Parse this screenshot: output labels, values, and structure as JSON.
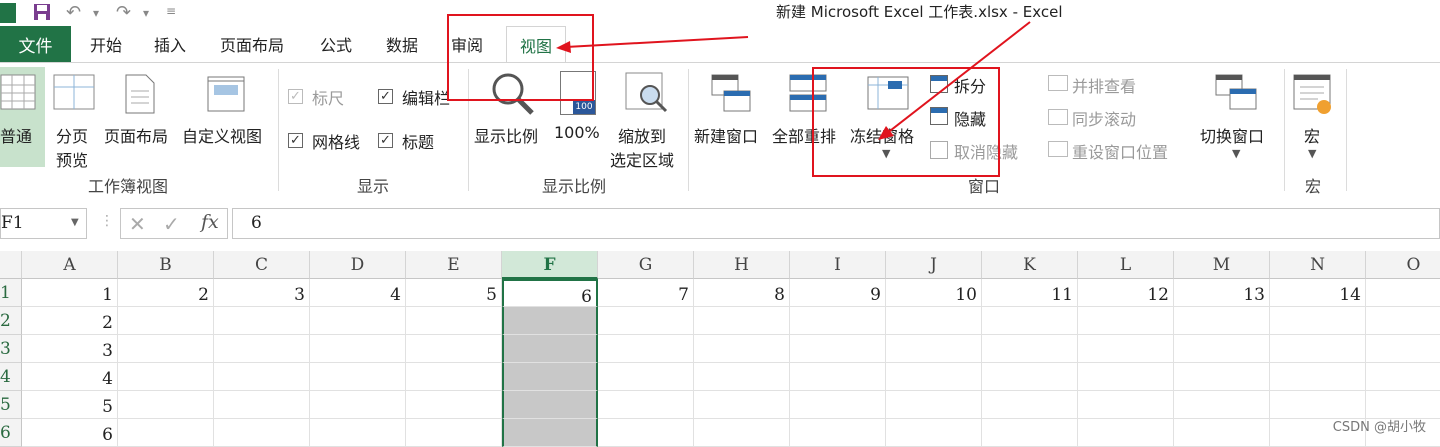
{
  "window": {
    "title": "新建 Microsoft Excel 工作表.xlsx - Excel"
  },
  "tabs": {
    "file": "文件",
    "items": [
      "开始",
      "插入",
      "页面布局",
      "公式",
      "数据",
      "审阅"
    ],
    "active": "视图"
  },
  "ribbon": {
    "workbook_views": {
      "label": "工作簿视图",
      "normal": "普通",
      "page_break_1": "分页",
      "page_break_2": "预览",
      "page_layout": "页面布局",
      "custom_views": "自定义视图"
    },
    "show": {
      "label": "显示",
      "ruler": "标尺",
      "formula_bar": "编辑栏",
      "gridlines": "网格线",
      "headings": "标题"
    },
    "zoom": {
      "label": "显示比例",
      "zoom": "显示比例",
      "hundred": "100%",
      "hundred_icon_text": "100",
      "zoom_to_selection_1": "缩放到",
      "zoom_to_selection_2": "选定区域"
    },
    "window": {
      "label": "窗口",
      "new_window": "新建窗口",
      "arrange_all": "全部重排",
      "freeze_panes": "冻结窗格",
      "split": "拆分",
      "hide": "隐藏",
      "unhide": "取消隐藏",
      "side_by_side": "并排查看",
      "sync_scroll": "同步滚动",
      "reset_position": "重设窗口位置",
      "switch_windows": "切换窗口"
    },
    "macros": {
      "label": "宏",
      "macros": "宏"
    }
  },
  "formula_bar": {
    "name_box": "F1",
    "fx": "fx",
    "value": "6"
  },
  "sheet": {
    "columns": [
      "A",
      "B",
      "C",
      "D",
      "E",
      "F",
      "G",
      "H",
      "I",
      "J",
      "K",
      "L",
      "M",
      "N",
      "O"
    ],
    "selected_column": "F",
    "rows": [
      {
        "num": "1",
        "cells": [
          "1",
          "2",
          "3",
          "4",
          "5",
          "6",
          "7",
          "8",
          "9",
          "10",
          "11",
          "12",
          "13",
          "14",
          ""
        ]
      },
      {
        "num": "2",
        "cells": [
          "2",
          "",
          "",
          "",
          "",
          "",
          "",
          "",
          "",
          "",
          "",
          "",
          "",
          "",
          ""
        ]
      },
      {
        "num": "3",
        "cells": [
          "3",
          "",
          "",
          "",
          "",
          "",
          "",
          "",
          "",
          "",
          "",
          "",
          "",
          "",
          ""
        ]
      },
      {
        "num": "4",
        "cells": [
          "4",
          "",
          "",
          "",
          "",
          "",
          "",
          "",
          "",
          "",
          "",
          "",
          "",
          "",
          ""
        ]
      },
      {
        "num": "5",
        "cells": [
          "5",
          "",
          "",
          "",
          "",
          "",
          "",
          "",
          "",
          "",
          "",
          "",
          "",
          "",
          ""
        ]
      },
      {
        "num": "6",
        "cells": [
          "6",
          "",
          "",
          "",
          "",
          "",
          "",
          "",
          "",
          "",
          "",
          "",
          "",
          "",
          ""
        ]
      }
    ]
  },
  "watermark": "CSDN @胡小牧",
  "colors": {
    "excel_green": "#217346",
    "annotation_red": "#e0141e",
    "selection_gray": "#c8c8c8"
  }
}
